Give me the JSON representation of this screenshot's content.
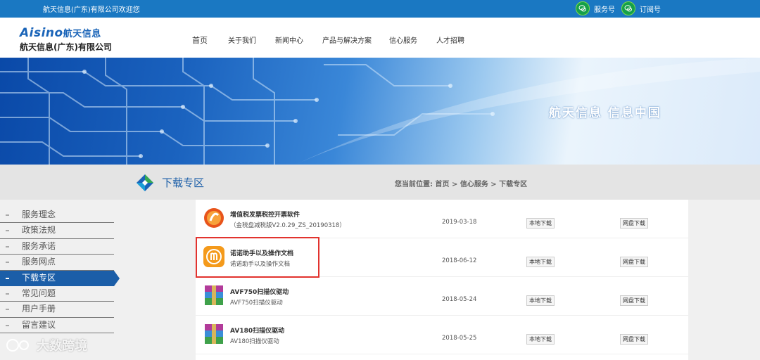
{
  "topbar": {
    "welcome": "航天信息(广东)有限公司欢迎您",
    "links": [
      {
        "icon": "wechat-icon",
        "label": "服务号"
      },
      {
        "icon": "wechat-icon",
        "label": "订阅号"
      }
    ]
  },
  "logo": {
    "brand_latin": "Aisino",
    "brand_cn": "航天信息",
    "company": "航天信息(广东)有限公司"
  },
  "nav": [
    "首页",
    "关于我们",
    "新闻中心",
    "产品与解决方案",
    "信心服务",
    "人才招聘"
  ],
  "banner": {
    "slogan": "航天信息 信息中国"
  },
  "section": {
    "title": "下载专区",
    "breadcrumb": "您当前位置: 首页 > 信心服务 > 下载专区"
  },
  "sidebar": {
    "items": [
      {
        "label": "服务理念"
      },
      {
        "label": "政策法规"
      },
      {
        "label": "服务承诺"
      },
      {
        "label": "服务网点"
      },
      {
        "label": "下载专区",
        "active": true
      },
      {
        "label": "常见问题"
      },
      {
        "label": "用户手册"
      },
      {
        "label": "留言建议"
      }
    ]
  },
  "downloads": [
    {
      "icon": "tax-software-icon",
      "name": "增值税发票税控开票软件",
      "desc": "（金税盘减税版V2.0.29_ZS_20190318）",
      "date": "2019-03-18",
      "local": "本地下载",
      "cloud": "网盘下载"
    },
    {
      "icon": "nuonuo-app-icon",
      "name": "诺诺助手以及操作文档",
      "desc": "诺诺助手以及操作文档",
      "date": "2018-06-12",
      "local": "本地下载",
      "cloud": "网盘下载"
    },
    {
      "icon": "winrar-archive-icon",
      "name": "AVF750扫描仪驱动",
      "desc": "AVF750扫描仪驱动",
      "date": "2018-05-24",
      "local": "本地下载",
      "cloud": "网盘下载"
    },
    {
      "icon": "winrar-archive-icon",
      "name": "AV180扫描仪驱动",
      "desc": "AV180扫描仪驱动",
      "date": "2018-05-25",
      "local": "本地下载",
      "cloud": "网盘下载"
    }
  ],
  "watermark": "大数跨境",
  "colors": {
    "primary": "#1a78c2",
    "nav_active": "#1b5ea8",
    "highlight": "#e2332e"
  }
}
